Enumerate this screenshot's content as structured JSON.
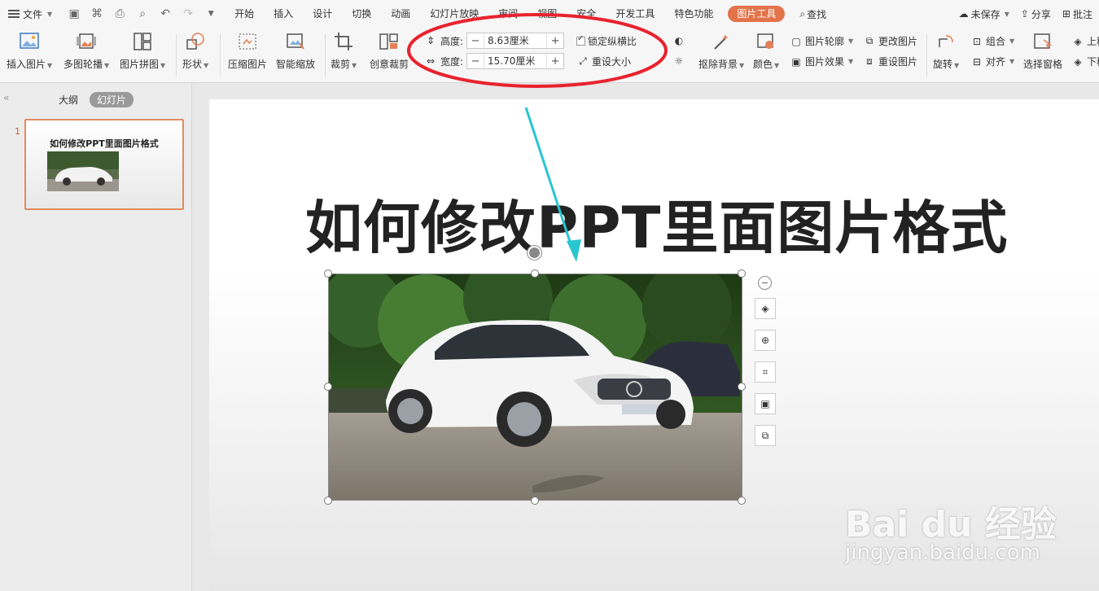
{
  "menubar": {
    "file_label": "文件",
    "tabs": [
      "开始",
      "插入",
      "设计",
      "切换",
      "动画",
      "幻灯片放映",
      "审阅",
      "视图",
      "安全",
      "开发工具",
      "特色功能"
    ],
    "active_tab": "图片工具",
    "search_label": "查找",
    "unsaved_label": "未保存",
    "share_label": "分享",
    "comment_label": "批注"
  },
  "ribbon": {
    "insert_image": "插入图片",
    "multi_carousel": "多图轮播",
    "collage": "图片拼图",
    "shape": "形状",
    "compress": "压缩图片",
    "smart_zoom": "智能缩放",
    "crop": "裁剪",
    "creative_crop": "创意裁剪",
    "height_label": "高度:",
    "height_value": "8.63厘米",
    "width_label": "宽度:",
    "width_value": "15.70厘米",
    "lock_ratio": "锁定纵横比",
    "reset_size": "重设大小",
    "remove_bg": "抠除背景",
    "color": "颜色",
    "outline": "图片轮廓",
    "effects": "图片效果",
    "change_image": "更改图片",
    "reset_image": "重设图片",
    "rotate": "旋转",
    "group": "组合",
    "align": "对齐",
    "select_pane": "选择窗格",
    "bring_up": "上移",
    "send_down": "下移"
  },
  "leftpanel": {
    "tab_outline": "大纲",
    "tab_slides": "幻灯片",
    "slide_number": "1",
    "thumb_title": "如何修改PPT里面图片格式"
  },
  "slide": {
    "title": "如何修改PPT里面图片格式"
  },
  "watermark": {
    "brand": "Bai du 经验",
    "url": "jingyan.baidu.com"
  },
  "colors": {
    "accent": "#e2734a",
    "annotation_red": "#e8232e",
    "annotation_arrow": "#28c6cf"
  }
}
